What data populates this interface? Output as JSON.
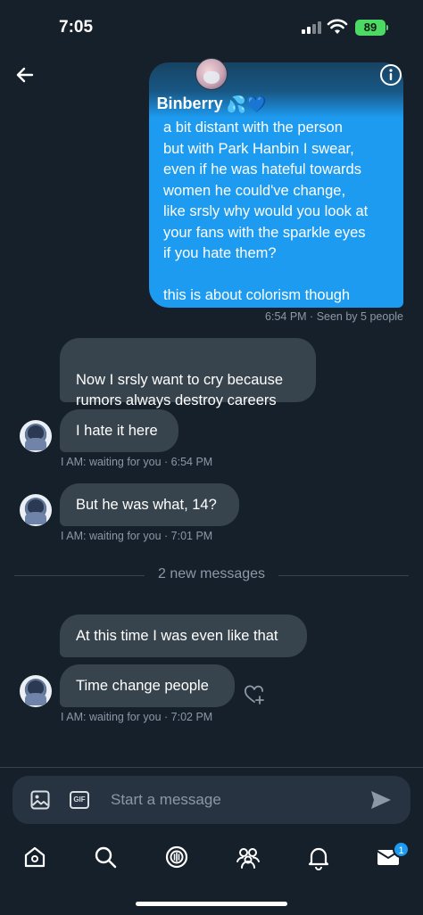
{
  "status_bar": {
    "time": "7:05",
    "battery": "89"
  },
  "header": {
    "contact_name": "Binberry",
    "name_emojis": "💦💙"
  },
  "outgoing": {
    "text": "a bit distant with the person\nbut with Park Hanbin I swear,\neven if he was hateful towards\nwomen he could've change,\nlike srsly why would you look at\nyour fans with the sparkle eyes\nif you hate them?\n\nthis is about colorism though",
    "meta": "6:54 PM · Seen by 5 people"
  },
  "incoming": [
    {
      "text": "Now I srsly want to cry because\nrumors always destroy careers"
    },
    {
      "text": "I hate it here",
      "meta": "I AM: waiting for you · 6:54 PM"
    },
    {
      "text": "But he was what, 14?",
      "meta": "I AM: waiting for you · 7:01 PM"
    },
    {
      "text": "At this time I was even like that"
    },
    {
      "text": "Time change people",
      "meta": "I AM: waiting for you · 7:02 PM"
    }
  ],
  "divider": {
    "label": "2 new messages"
  },
  "composer": {
    "placeholder": "Start a message",
    "gif_label": "GIF"
  },
  "nav": {
    "messages_badge": "1"
  },
  "colors": {
    "background": "#15202b",
    "outgoing_bubble": "#1d9bf0",
    "incoming_bubble": "#38444d",
    "meta_text": "#8b98a5"
  },
  "icons": [
    "back-arrow-icon",
    "info-icon",
    "image-icon",
    "gif-icon",
    "send-icon",
    "home-icon",
    "search-icon",
    "spaces-icon",
    "communities-icon",
    "bell-icon",
    "mail-icon",
    "heart-plus-icon"
  ]
}
